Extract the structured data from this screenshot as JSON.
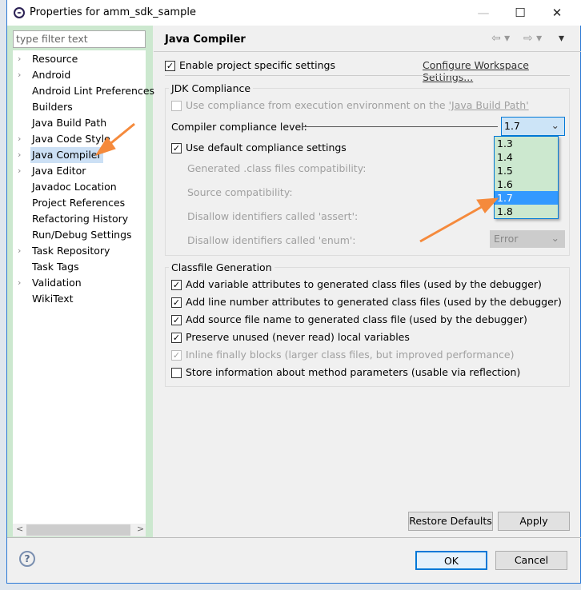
{
  "window": {
    "title": "Properties for amm_sdk_sample",
    "minimize": "—",
    "maximize": "☐",
    "close": "✕"
  },
  "filter": {
    "placeholder": "type filter text"
  },
  "tree": [
    {
      "label": "Resource",
      "expandable": true
    },
    {
      "label": "Android",
      "expandable": true
    },
    {
      "label": "Android Lint Preferences",
      "expandable": false
    },
    {
      "label": "Builders",
      "expandable": false
    },
    {
      "label": "Java Build Path",
      "expandable": false
    },
    {
      "label": "Java Code Style",
      "expandable": true
    },
    {
      "label": "Java Compiler",
      "expandable": true,
      "selected": true
    },
    {
      "label": "Java Editor",
      "expandable": true
    },
    {
      "label": "Javadoc Location",
      "expandable": false
    },
    {
      "label": "Project References",
      "expandable": false
    },
    {
      "label": "Refactoring History",
      "expandable": false
    },
    {
      "label": "Run/Debug Settings",
      "expandable": false
    },
    {
      "label": "Task Repository",
      "expandable": true
    },
    {
      "label": "Task Tags",
      "expandable": false
    },
    {
      "label": "Validation",
      "expandable": true
    },
    {
      "label": "WikiText",
      "expandable": false
    }
  ],
  "page": {
    "title": "Java Compiler",
    "enable_project": "Enable project specific settings",
    "configure_link": "Configure Workspace Settings...",
    "jdk_group": "JDK Compliance",
    "use_env": "Use compliance from execution environment on the ",
    "use_env_link": "'Java Build Path'",
    "compliance_label": "Compiler compliance level:",
    "compliance_value": "1.7",
    "compliance_options": [
      "1.3",
      "1.4",
      "1.5",
      "1.6",
      "1.7",
      "1.8"
    ],
    "use_default": "Use default compliance settings",
    "generated": "Generated .class files compatibility:",
    "source": "Source compatibility:",
    "assert": "Disallow identifiers called 'assert':",
    "enum": "Disallow identifiers called 'enum':",
    "enum_value": "Error",
    "classfile_group": "Classfile Generation",
    "cf": [
      {
        "label": "Add variable attributes to generated class files (used by the debugger)",
        "checked": true
      },
      {
        "label": "Add line number attributes to generated class files (used by the debugger)",
        "checked": true
      },
      {
        "label": "Add source file name to generated class file (used by the debugger)",
        "checked": true
      },
      {
        "label": "Preserve unused (never read) local variables",
        "checked": true
      },
      {
        "label": "Inline finally blocks (larger class files, but improved performance)",
        "checked": true,
        "disabled": true
      },
      {
        "label": "Store information about method parameters (usable via reflection)",
        "checked": false
      }
    ]
  },
  "buttons": {
    "restore": "Restore Defaults",
    "apply": "Apply",
    "ok": "OK",
    "cancel": "Cancel",
    "help": "?"
  },
  "colors": {
    "accent": "#0078d7",
    "selection": "#3399ff",
    "annotation_arrow": "#f58a3c"
  }
}
